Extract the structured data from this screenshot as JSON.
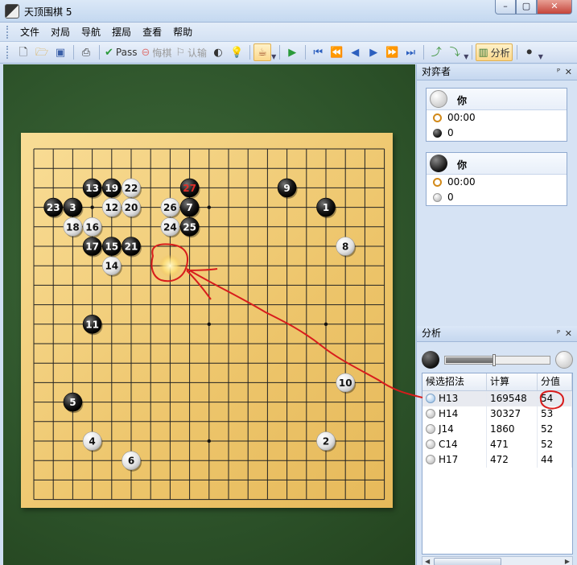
{
  "window": {
    "title": "天顶围棋 5",
    "min": "–",
    "max": "▢",
    "close": "✕"
  },
  "menu": [
    "文件",
    "对局",
    "导航",
    "摆局",
    "查看",
    "帮助"
  ],
  "toolbar": {
    "pass_label": "Pass",
    "undo_label": "悔棋",
    "resign_label": "认输",
    "analysis_label": "分析"
  },
  "players_panel": {
    "title": "对弈者",
    "pin": "ᴾ",
    "close": "✕",
    "white": {
      "name": "你",
      "time": "00:00",
      "captures": "0"
    },
    "black": {
      "name": "你",
      "time": "00:00",
      "captures": "0"
    }
  },
  "analysis_panel": {
    "title": "分析",
    "pin": "ᴾ",
    "close": "✕",
    "balance": 0.46,
    "columns": [
      "候选招法",
      "计算",
      "分值"
    ],
    "rows": [
      {
        "move": "H13",
        "calc": "169548",
        "score": "54"
      },
      {
        "move": "H14",
        "calc": "30327",
        "score": "53"
      },
      {
        "move": "J14",
        "calc": "1860",
        "score": "52"
      },
      {
        "move": "C14",
        "calc": "471",
        "score": "52"
      },
      {
        "move": "H17",
        "calc": "472",
        "score": "44"
      }
    ]
  },
  "board": {
    "size": 19,
    "stones": [
      {
        "n": "1",
        "c": "B",
        "col": 15,
        "row": 3
      },
      {
        "n": "2",
        "c": "W",
        "col": 15,
        "row": 15
      },
      {
        "n": "3",
        "c": "B",
        "col": 2,
        "row": 3
      },
      {
        "n": "4",
        "c": "W",
        "col": 3,
        "row": 15
      },
      {
        "n": "5",
        "c": "B",
        "col": 2,
        "row": 13
      },
      {
        "n": "6",
        "c": "W",
        "col": 5,
        "row": 16
      },
      {
        "n": "7",
        "c": "B",
        "col": 8,
        "row": 3
      },
      {
        "n": "8",
        "c": "W",
        "col": 16,
        "row": 5
      },
      {
        "n": "9",
        "c": "B",
        "col": 13,
        "row": 2
      },
      {
        "n": "10",
        "c": "W",
        "col": 16,
        "row": 12
      },
      {
        "n": "11",
        "c": "B",
        "col": 3,
        "row": 9
      },
      {
        "n": "12",
        "c": "W",
        "col": 4,
        "row": 3
      },
      {
        "n": "13",
        "c": "B",
        "col": 3,
        "row": 2
      },
      {
        "n": "14",
        "c": "W",
        "col": 4,
        "row": 6
      },
      {
        "n": "15",
        "c": "B",
        "col": 4,
        "row": 5
      },
      {
        "n": "16",
        "c": "W",
        "col": 3,
        "row": 4
      },
      {
        "n": "17",
        "c": "B",
        "col": 3,
        "row": 5
      },
      {
        "n": "18",
        "c": "W",
        "col": 2,
        "row": 4
      },
      {
        "n": "19",
        "c": "B",
        "col": 4,
        "row": 2
      },
      {
        "n": "20",
        "c": "W",
        "col": 5,
        "row": 3
      },
      {
        "n": "21",
        "c": "B",
        "col": 5,
        "row": 5
      },
      {
        "n": "22",
        "c": "W",
        "col": 5,
        "row": 2
      },
      {
        "n": "23",
        "c": "B",
        "col": 1,
        "row": 3
      },
      {
        "n": "24",
        "c": "W",
        "col": 7,
        "row": 4
      },
      {
        "n": "25",
        "c": "B",
        "col": 8,
        "row": 4
      },
      {
        "n": "26",
        "c": "W",
        "col": 7,
        "row": 3
      },
      {
        "n": "27",
        "c": "B",
        "col": 8,
        "row": 2,
        "last": true
      }
    ],
    "hint": {
      "col": 7,
      "row": 6
    },
    "colors": {
      "last_move": "#e0302a",
      "annotation": "#d81c1c"
    }
  }
}
